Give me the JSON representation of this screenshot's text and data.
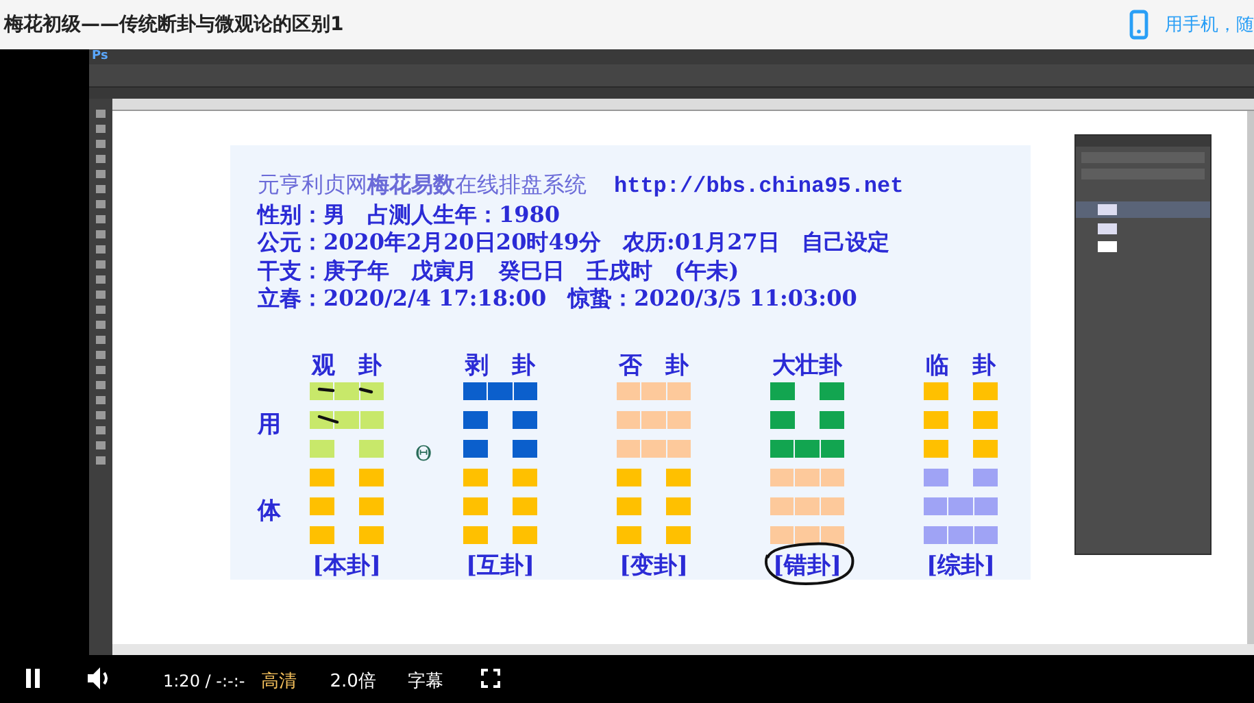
{
  "page": {
    "title": "梅花初级——传统断卦与微观论的区别1",
    "mobile_link": "用手机，随"
  },
  "photoshop": {
    "logo": "Ps"
  },
  "chart": {
    "header": [
      {
        "kind": "site",
        "prefix": "元亨利贞网",
        "bold": "梅花易数",
        "suffix": "在线排盘系统",
        "url": "http://bbs.china95.net"
      },
      {
        "kind": "line",
        "text": "性别：男　占测人生年：1980"
      },
      {
        "kind": "line",
        "text": "公元：2020年2月20日20时49分　农历:01月27日　自己设定"
      },
      {
        "kind": "line",
        "text": "干支：庚子年　戊寅月　癸巳日　壬戌时　(午未)"
      },
      {
        "kind": "line",
        "text": "立春：2020/2/4 17:18:00　惊蛰：2020/3/5 11:03:00"
      }
    ],
    "side_labels": [
      "用",
      "体"
    ],
    "symbol": "Θ",
    "hexagrams": [
      {
        "name": "观　卦",
        "label": "[本卦]",
        "circled": false,
        "marked": true,
        "lines": [
          {
            "yang": true,
            "color": "#c8e86a"
          },
          {
            "yang": true,
            "color": "#c8e86a"
          },
          {
            "yang": false,
            "color": "#c8e86a"
          },
          {
            "yang": false,
            "color": "#ffc000"
          },
          {
            "yang": false,
            "color": "#ffc000"
          },
          {
            "yang": false,
            "color": "#ffc000"
          }
        ]
      },
      {
        "name": "剥　卦",
        "label": "[互卦]",
        "circled": false,
        "marked": false,
        "lines": [
          {
            "yang": true,
            "color": "#0b5fcc"
          },
          {
            "yang": false,
            "color": "#0b5fcc"
          },
          {
            "yang": false,
            "color": "#0b5fcc"
          },
          {
            "yang": false,
            "color": "#ffc000"
          },
          {
            "yang": false,
            "color": "#ffc000"
          },
          {
            "yang": false,
            "color": "#ffc000"
          }
        ]
      },
      {
        "name": "否　卦",
        "label": "[变卦]",
        "circled": false,
        "marked": false,
        "lines": [
          {
            "yang": true,
            "color": "#fdc99b"
          },
          {
            "yang": true,
            "color": "#fdc99b"
          },
          {
            "yang": true,
            "color": "#fdc99b"
          },
          {
            "yang": false,
            "color": "#ffc000"
          },
          {
            "yang": false,
            "color": "#ffc000"
          },
          {
            "yang": false,
            "color": "#ffc000"
          }
        ]
      },
      {
        "name": "大壮卦",
        "label": "[错卦]",
        "circled": true,
        "marked": false,
        "lines": [
          {
            "yang": false,
            "color": "#12a550"
          },
          {
            "yang": false,
            "color": "#12a550"
          },
          {
            "yang": true,
            "color": "#12a550"
          },
          {
            "yang": true,
            "color": "#fdc99b"
          },
          {
            "yang": true,
            "color": "#fdc99b"
          },
          {
            "yang": true,
            "color": "#fdc99b"
          }
        ]
      },
      {
        "name": "临　卦",
        "label": "[综卦]",
        "circled": false,
        "marked": false,
        "lines": [
          {
            "yang": false,
            "color": "#ffc000"
          },
          {
            "yang": false,
            "color": "#ffc000"
          },
          {
            "yang": false,
            "color": "#ffc000"
          },
          {
            "yang": false,
            "color": "#9fa3f5"
          },
          {
            "yang": true,
            "color": "#9fa3f5"
          },
          {
            "yang": true,
            "color": "#9fa3f5"
          }
        ]
      }
    ]
  },
  "player": {
    "playing": true,
    "time": "1:20",
    "separator": "/",
    "duration": "-:-:-",
    "quality": "高清",
    "speed": "2.0倍",
    "subtitles": "字幕"
  }
}
